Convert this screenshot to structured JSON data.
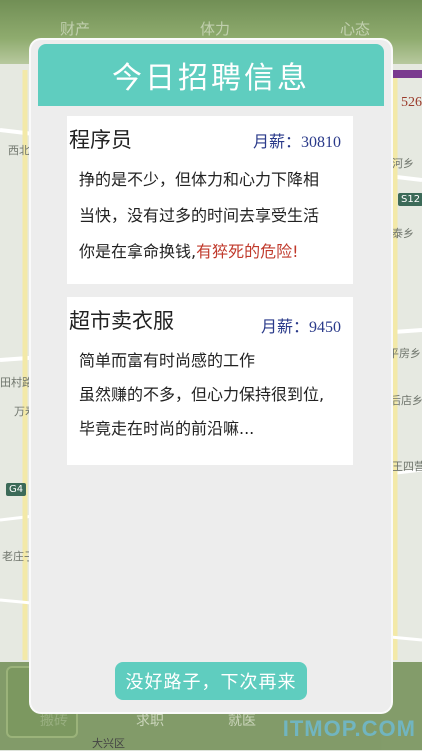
{
  "background": {
    "top_tabs": [
      "财产",
      "体力",
      "",
      "心态"
    ],
    "stat_number": "526",
    "map_labels": [
      "西北",
      "河乡",
      "泰乡",
      "平房乡",
      "后店乡",
      "田村路",
      "万寿",
      "王四营",
      "老庄子",
      "大兴区"
    ],
    "road_badges": [
      "S12",
      "G4"
    ],
    "bottom_tabs": [
      "搬砖",
      "求职",
      "就医"
    ],
    "watermark": "ITMOP.COM"
  },
  "dialog": {
    "title": "今日招聘信息",
    "jobs": [
      {
        "title": "程序员",
        "salary_label": "月薪：",
        "salary": "30810",
        "lines": [
          "挣的是不少，但体力和心力下降相",
          "当快，没有过多的时间去享受生活"
        ],
        "last_line_prefix": "你是在拿命换钱,",
        "last_line_warning": "有猝死的危险!"
      },
      {
        "title": "超市卖衣服",
        "salary_label": "月薪：",
        "salary": "9450",
        "lines": [
          "简单而富有时尚感的工作",
          "虽然赚的不多，但心力保持很到位,",
          "毕竟走在时尚的前沿嘛..."
        ]
      }
    ],
    "button_label": "没好路子，下次再来"
  },
  "colors": {
    "header": "#5fcdbf",
    "button": "#5fcdbf",
    "danger_text": "#c0392b",
    "salary_text": "#2a3a8a"
  }
}
